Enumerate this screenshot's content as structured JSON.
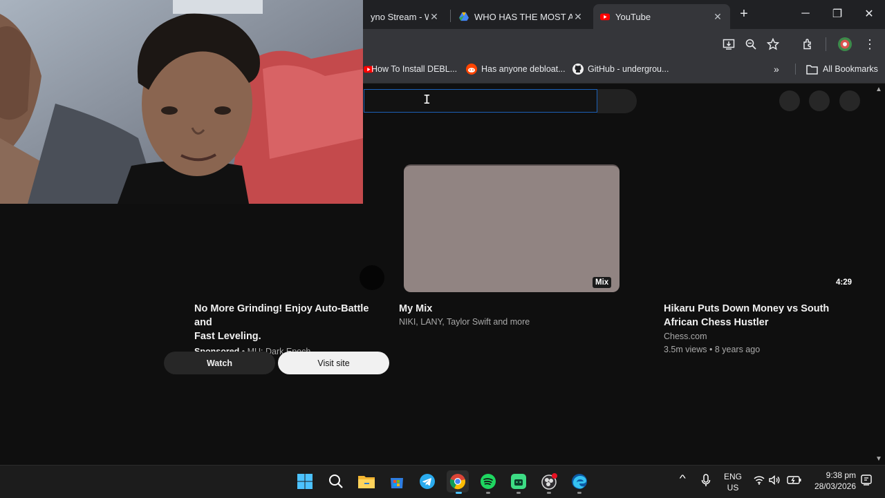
{
  "browser": {
    "tabs": [
      {
        "title": "yno Stream - Wat",
        "close": "✕",
        "favicon": "youtube-favicon"
      },
      {
        "title": "WHO HAS THE MOST AU",
        "close": "✕",
        "favicon": "google-drive-favicon"
      },
      {
        "title": "YouTube",
        "close": "✕",
        "favicon": "youtube-favicon",
        "active": true
      }
    ],
    "new_tab": "+",
    "window_controls": {
      "minimize": "─",
      "restore": "❐",
      "close": "✕"
    },
    "bookmarks": [
      {
        "label": "How To Install DEBL...",
        "icon": "youtube-favicon"
      },
      {
        "label": "Has anyone debloat...",
        "icon": "reddit-icon"
      },
      {
        "label": "GitHub - undergrou...",
        "icon": "github-icon"
      }
    ],
    "bookmarks_overflow": "»",
    "all_bookmarks": "All Bookmarks"
  },
  "youtube": {
    "videos": [
      {
        "title_line1": "No More Grinding! Enjoy Auto-Battle and",
        "title_line2": "Fast Leveling.",
        "sponsored": "Sponsored",
        "channel": " • MU: Dark Epoch",
        "watch_label": "Watch",
        "visit_label": "Visit site"
      },
      {
        "title": "My Mix",
        "subtitle": "NIKI, LANY, Taylor Swift and more",
        "badge": "Mix"
      },
      {
        "title_line1": "Hikaru Puts Down Money vs South",
        "title_line2": "African Chess Hustler",
        "channel": "Chess.com",
        "meta": "3.5m views • 8 years ago",
        "duration": "4:29"
      }
    ]
  },
  "taskbar": {
    "apps": [
      "windows-start-icon",
      "search-icon",
      "file-explorer-icon",
      "microsoft-store-icon",
      "telegram-icon",
      "chrome-icon",
      "spotify-icon",
      "android-app-icon",
      "obs-icon",
      "edge-icon"
    ],
    "tray": {
      "chevron": "^",
      "lang_top": "ENG",
      "lang_bottom": "US",
      "time": "9:38 pm",
      "date": "28/03/2026"
    }
  },
  "colors": {
    "chrome_dark": "#202124",
    "chrome_toolbar": "#35363a",
    "youtube_bg": "#0f0f0f",
    "youtube_red": "#ff0000",
    "focus_blue": "#1c62b9",
    "mix_thumb": "#918482"
  }
}
